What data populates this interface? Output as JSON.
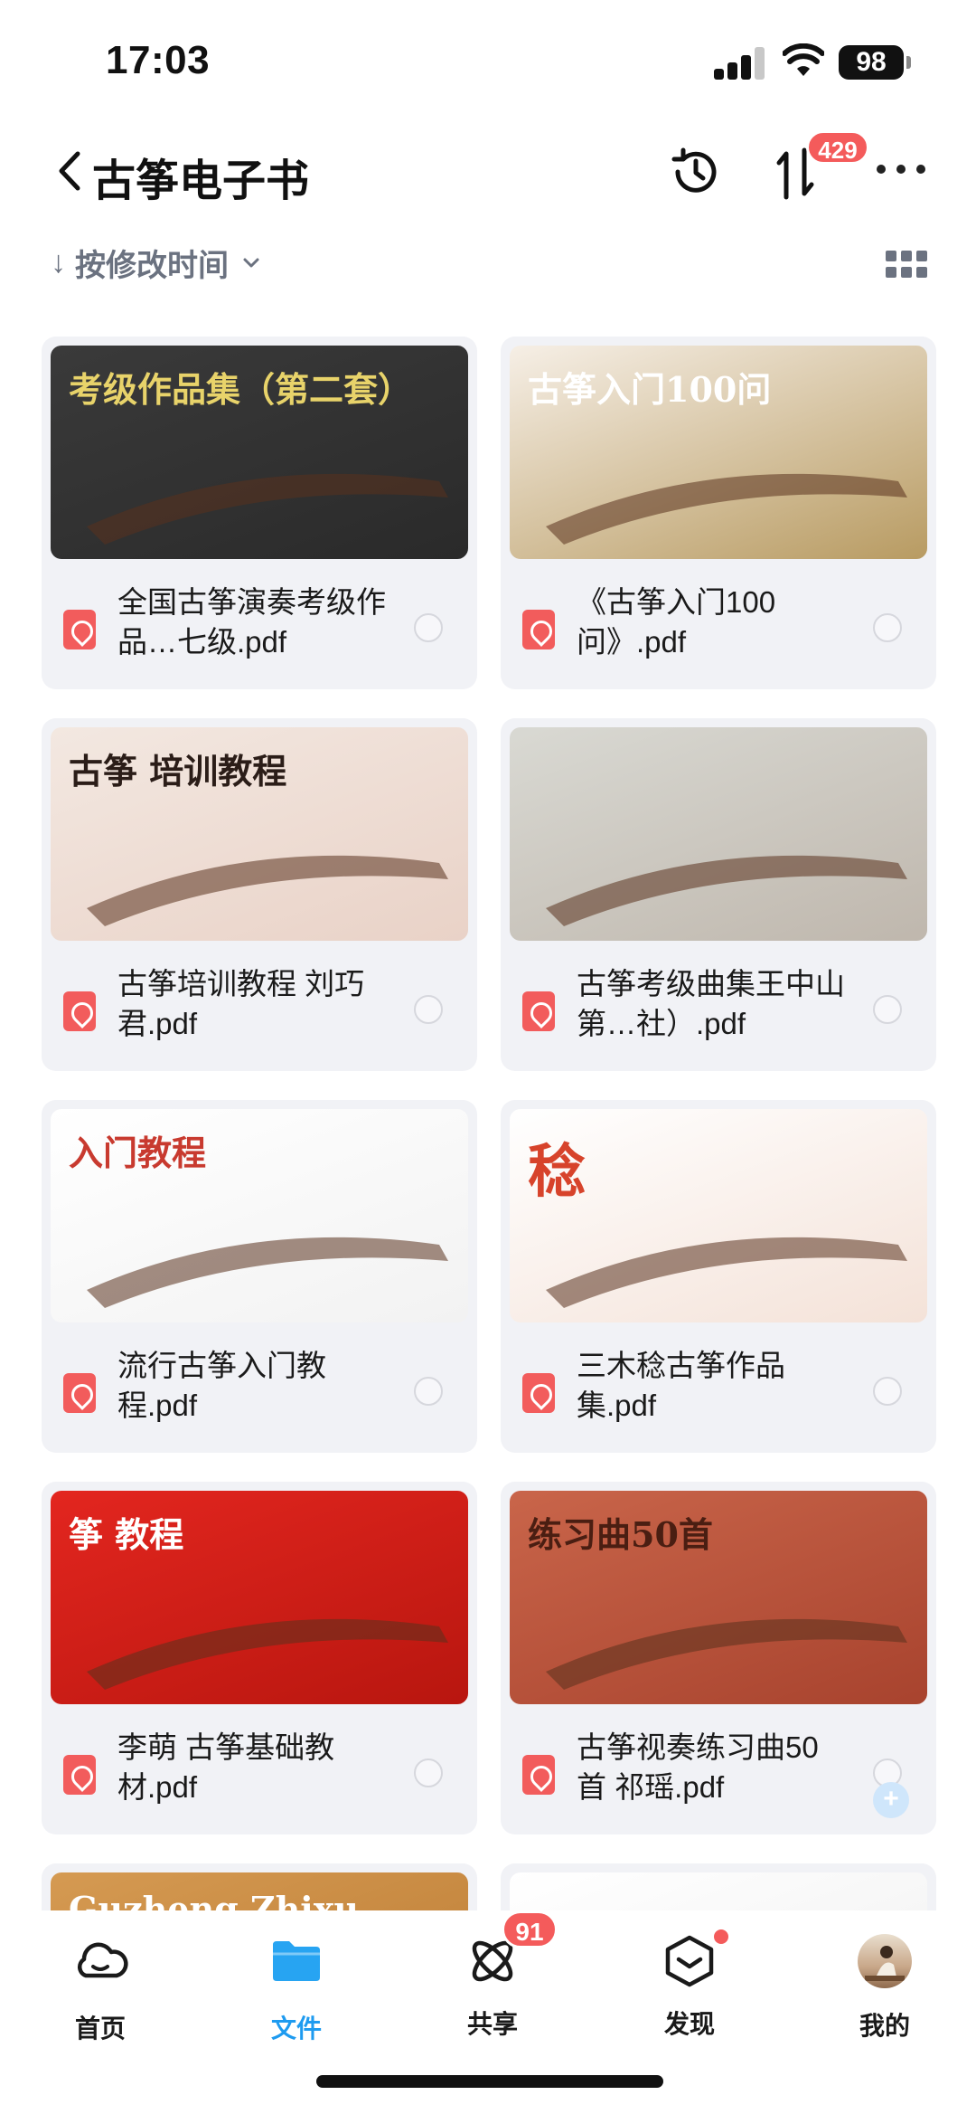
{
  "status_bar": {
    "time": "17:03",
    "battery": "98"
  },
  "header": {
    "title": "古筝电子书",
    "sort_badge": "429"
  },
  "sort": {
    "label": "按修改时间",
    "arrow": "↓"
  },
  "files": [
    {
      "name": "全国古筝演奏考级作品…七级.pdf",
      "thumb_text": "考级作品集（第二套）",
      "thumb_colors": [
        "#3a3a3a",
        "#2a2a2a"
      ],
      "thumb_text_color": "#e8d36a"
    },
    {
      "name": "《古筝入门100问》.pdf",
      "thumb_text": "古筝入门100问",
      "thumb_colors": [
        "#f6efe6",
        "#b89b62"
      ],
      "thumb_text_color": "#ffffff"
    },
    {
      "name": "古筝培训教程 刘巧君.pdf",
      "thumb_text": "古筝 培训教程",
      "thumb_colors": [
        "#f3e8e1",
        "#e9d2c7"
      ],
      "thumb_text_color": "#2b1d18"
    },
    {
      "name": "古筝考级曲集王中山第…社）.pdf",
      "thumb_text": "",
      "thumb_colors": [
        "#d9d9d3",
        "#bfb7ad"
      ],
      "thumb_text_color": "#5a3d2a"
    },
    {
      "name": "流行古筝入门教程.pdf",
      "thumb_text": "入门教程",
      "thumb_colors": [
        "#ffffff",
        "#f2f2f2"
      ],
      "thumb_text_color": "#c83a2f"
    },
    {
      "name": "三木稔古筝作品集.pdf",
      "thumb_text": "稔",
      "thumb_colors": [
        "#ffffff",
        "#f4e2d8"
      ],
      "thumb_text_color": "#d7432b"
    },
    {
      "name": "李萌 古筝基础教材.pdf",
      "thumb_text": "筝 教程",
      "thumb_colors": [
        "#e3261f",
        "#b8160f"
      ],
      "thumb_text_color": "#ffffff"
    },
    {
      "name": "古筝视奏练习曲50首 祁瑶.pdf",
      "thumb_text": "练习曲50首",
      "thumb_colors": [
        "#c9654a",
        "#a8432e"
      ],
      "thumb_text_color": "#4a1e12"
    },
    {
      "name": "",
      "thumb_text": "Guzheng Zhixu Lianxiqu",
      "thumb_colors": [
        "#d59a52",
        "#b97830"
      ],
      "thumb_text_color": "#ffffff"
    },
    {
      "name": "",
      "thumb_text": "",
      "thumb_colors": [
        "#ffffff",
        "#eeeeee"
      ],
      "thumb_text_color": "#555555"
    }
  ],
  "tabs": [
    {
      "label": "首页",
      "icon": "cloud-icon"
    },
    {
      "label": "文件",
      "icon": "folder-icon",
      "active": true
    },
    {
      "label": "共享",
      "icon": "share-orbit-icon",
      "badge": "91"
    },
    {
      "label": "发现",
      "icon": "discover-box-icon",
      "dot": true
    },
    {
      "label": "我的",
      "icon": "avatar"
    }
  ],
  "colors": {
    "accent": "#1e9bf0",
    "badge": "#f45b5b",
    "card_bg": "#f1f2f6"
  }
}
